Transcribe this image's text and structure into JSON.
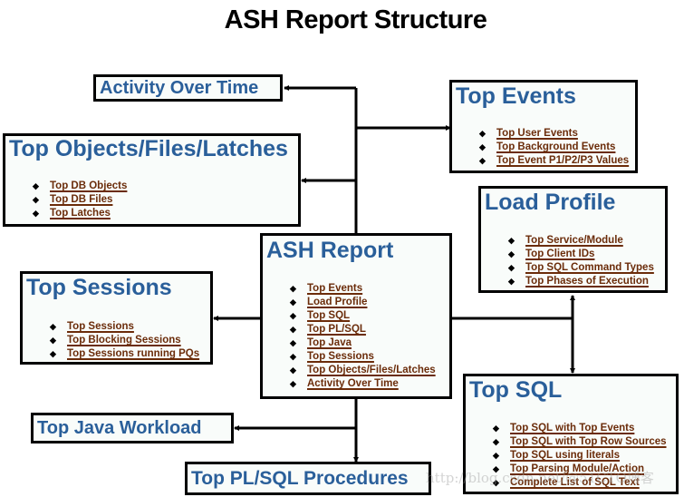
{
  "title": "ASH Report Structure",
  "colors": {
    "heading": "#2a5f9a",
    "link": "#6b2c0a",
    "border": "#000000",
    "box_bg": "#f9fcfa"
  },
  "boxes": {
    "ash_report": {
      "heading": "ASH Report",
      "items": [
        "Top Events",
        "Load Profile",
        "Top SQL",
        "Top PL/SQL",
        "Top Java",
        "Top Sessions",
        "Top Objects/Files/Latches",
        "Activity Over Time"
      ]
    },
    "activity_over_time": {
      "heading": "Activity Over Time"
    },
    "top_objects": {
      "heading": "Top Objects/Files/Latches",
      "items": [
        "Top DB Objects",
        "Top DB Files",
        "Top Latches"
      ]
    },
    "top_events": {
      "heading": "Top Events",
      "items": [
        "Top User Events",
        "Top Background Events",
        "Top Event P1/P2/P3 Values"
      ]
    },
    "load_profile": {
      "heading": "Load Profile",
      "items": [
        "Top Service/Module",
        "Top Client IDs",
        "Top SQL Command Types",
        "Top Phases of Execution"
      ]
    },
    "top_sessions": {
      "heading": "Top Sessions",
      "items": [
        "Top Sessions",
        "Top Blocking Sessions",
        "Top Sessions running PQs"
      ]
    },
    "top_sql": {
      "heading": "Top SQL",
      "items": [
        "Top SQL with Top Events",
        "Top SQL with Top Row Sources",
        "Top SQL using literals",
        "Top Parsing Module/Action",
        "Complete List of SQL Text"
      ]
    },
    "top_java": {
      "heading": "Top Java Workload"
    },
    "top_plsql": {
      "heading": "Top PL/SQL Procedures"
    }
  },
  "watermark": "http://blog.csdn.net/@51CTO博客"
}
